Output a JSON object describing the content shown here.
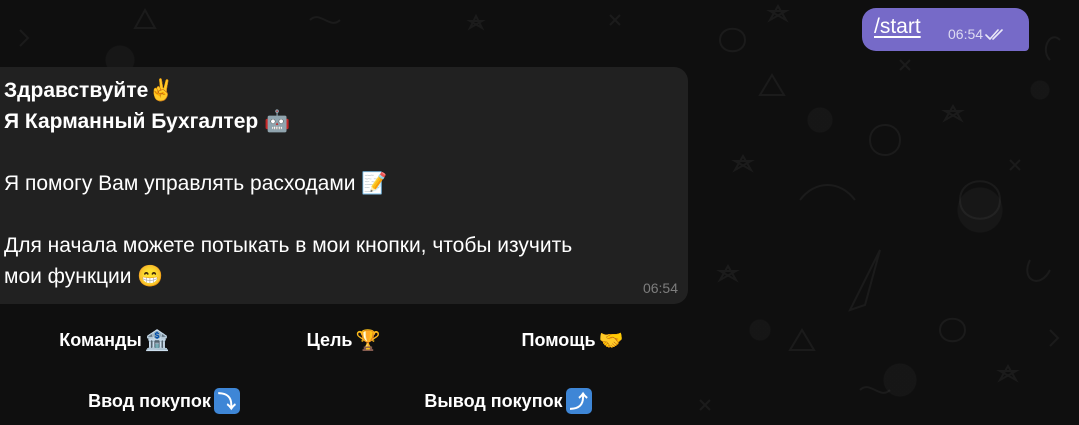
{
  "outgoing_message": {
    "text": "/start",
    "time": "06:54"
  },
  "incoming_message": {
    "lines": [
      "Здравствуйте✌",
      "Я Карманный Бухгалтер 🤖",
      "",
      "Я помогу Вам управлять расходами 📝",
      "",
      "Для начала можете потыкать в мои кнопки, чтобы изучить",
      "мои функции 😁"
    ],
    "time": "06:54"
  },
  "keyboard": {
    "row1": [
      {
        "label": "Команды",
        "emoji": "🏦"
      },
      {
        "label": "Цель",
        "emoji": "🏆"
      },
      {
        "label": "Помощь",
        "emoji": "🤝"
      }
    ],
    "row2": [
      {
        "label": "Ввод покупок",
        "emoji": "⤵"
      },
      {
        "label": "Вывод покупок",
        "emoji": "⤴"
      }
    ]
  },
  "colors": {
    "background": "#0f0f0f",
    "outgoing_bubble": "#766ac8",
    "incoming_bubble": "#212121",
    "arrow_button": "#3e86d6"
  }
}
